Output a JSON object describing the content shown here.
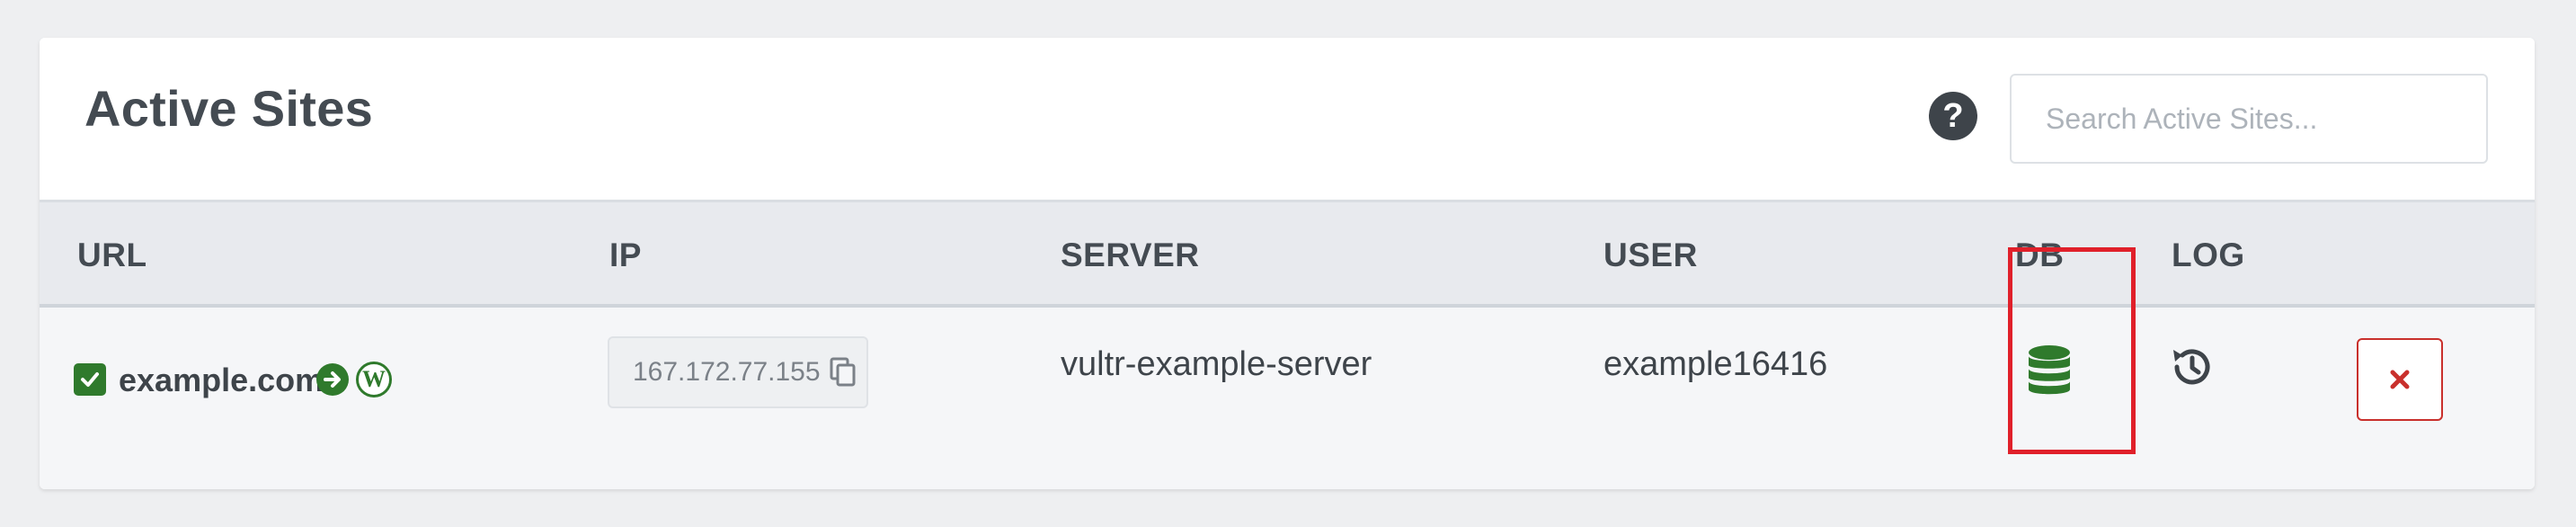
{
  "header": {
    "title": "Active Sites",
    "help_icon": "question-circle-icon",
    "help_symbol": "?",
    "search_placeholder": "Search Active Sites..."
  },
  "table": {
    "columns": [
      "URL",
      "IP",
      "SERVER",
      "USER",
      "DB",
      "LOG"
    ],
    "rows": [
      {
        "selected": true,
        "url": "example.com",
        "ip": "167.172.77.155",
        "server": "vultr-example-server",
        "user": "example16416",
        "db_icon": "database-icon",
        "log_icon": "history-icon",
        "wordpress_mark": "W"
      }
    ]
  },
  "colors": {
    "accent_green": "#2f7a2c",
    "danger_red": "#c9302c",
    "highlight_red": "#e0202a"
  }
}
